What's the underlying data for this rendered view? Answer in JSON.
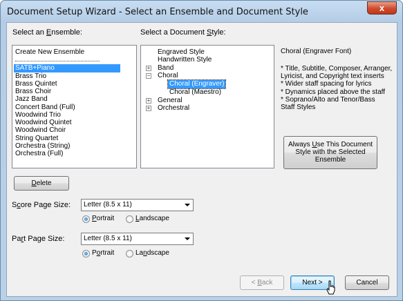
{
  "window": {
    "title": "Document Setup Wizard - Select an Ensemble and Document Style",
    "close_glyph": "x"
  },
  "ensemble": {
    "label_pre": "Select an ",
    "label_u": "E",
    "label_post": "nsemble:",
    "create_new": "Create New Ensemble",
    "items": [
      "SATB+Piano",
      "Brass Trio",
      "Brass Quintet",
      "Brass Choir",
      "Jazz Band",
      "Concert Band (Full)",
      "Woodwind Trio",
      "Woodwind Quintet",
      "Woodwind Choir",
      "String Quartet",
      "Orchestra (String)",
      "Orchestra (Full)"
    ],
    "selected": "SATB+Piano"
  },
  "style": {
    "label_pre": "Select a Document ",
    "label_u": "S",
    "label_post": "tyle:",
    "tree": {
      "engraved": "Engraved Style",
      "handwritten": "Handwritten Style",
      "band": "Band",
      "choral": "Choral",
      "choral_engraver": "Choral (Engraver)",
      "choral_maestro": "Choral (Maestro)",
      "general": "General",
      "orchestral": "Orchestral"
    },
    "expander_plus": "+",
    "expander_minus": "−"
  },
  "description": {
    "title": "Choral (Engraver Font)",
    "lines": [
      "* Title, Subtitle, Composer, Arranger,",
      "Lyricist, and Copyright text inserts",
      "* Wider staff spacing for lyrics",
      "* Dynamics placed above the staff",
      "* Soprano/Alto and Tenor/Bass",
      "Staff Styles"
    ]
  },
  "always_use": {
    "pre": "Always ",
    "u": "U",
    "post": "se This Document",
    "line2": "Style with the Selected",
    "line3": "Ensemble"
  },
  "delete_button": {
    "u": "D",
    "post": "elete"
  },
  "score": {
    "label_pre": "S",
    "label_u": "c",
    "label_post": "ore Page Size:",
    "value": "Letter (8.5 x 11)",
    "portrait_u": "P",
    "portrait_post": "ortrait",
    "landscape_u": "L",
    "landscape_post": "andscape",
    "orientation": "Portrait"
  },
  "part": {
    "label_pre": "Pa",
    "label_u": "r",
    "label_post": "t Page Size:",
    "value": "Letter (8.5 x 11)",
    "portrait_pre": "P",
    "portrait_u": "o",
    "portrait_post": "rtrait",
    "landscape_pre": "La",
    "landscape_u": "n",
    "landscape_post": "dscape",
    "orientation": "Portrait"
  },
  "nav": {
    "back_pre": "< ",
    "back_u": "B",
    "back_post": "ack",
    "next": "Next >",
    "cancel": "Cancel"
  }
}
